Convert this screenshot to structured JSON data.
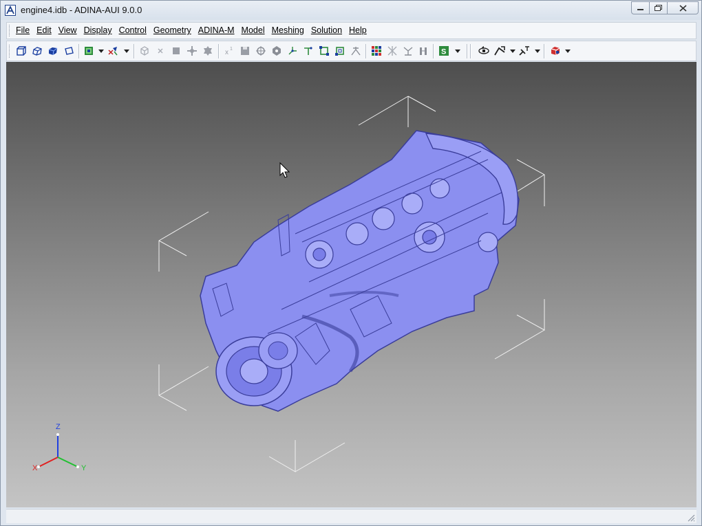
{
  "window": {
    "title": "engine4.idb - ADINA-AUI  9.0.0",
    "controls": [
      "minimize",
      "maximize",
      "close"
    ]
  },
  "menubar": {
    "items": [
      "File",
      "Edit",
      "View",
      "Display",
      "Control",
      "Geometry",
      "ADINA-M",
      "Model",
      "Meshing",
      "Solution",
      "Help"
    ]
  },
  "toolbar": {
    "icons": [
      "view-front-icon",
      "view-iso-icon",
      "shaded-view-icon",
      "wireframe-view-icon",
      "zone-icon",
      "symbol-plot-icon",
      "cube-icon",
      "delete-icon",
      "square-icon",
      "move-icon",
      "gear-body-icon",
      "coordinate-icon",
      "save-icon",
      "point-icon",
      "node-icon",
      "axis-icon",
      "line-icon",
      "frame-icon",
      "box-frame-icon",
      "scatter-icon",
      "mesh-color-icon",
      "mesh-node-icon",
      "mesh-branch-icon",
      "mesh-bar-icon",
      "solution-icon",
      "rotate-icon",
      "pan-icon",
      "zoom-icon",
      "color-cube-icon"
    ]
  },
  "viewport": {
    "model_color": "#8b8ff0",
    "axis": {
      "x": "X",
      "y": "Y",
      "z": "Z",
      "x_color": "#e02020",
      "y_color": "#20c030",
      "z_color": "#2040e0"
    }
  }
}
